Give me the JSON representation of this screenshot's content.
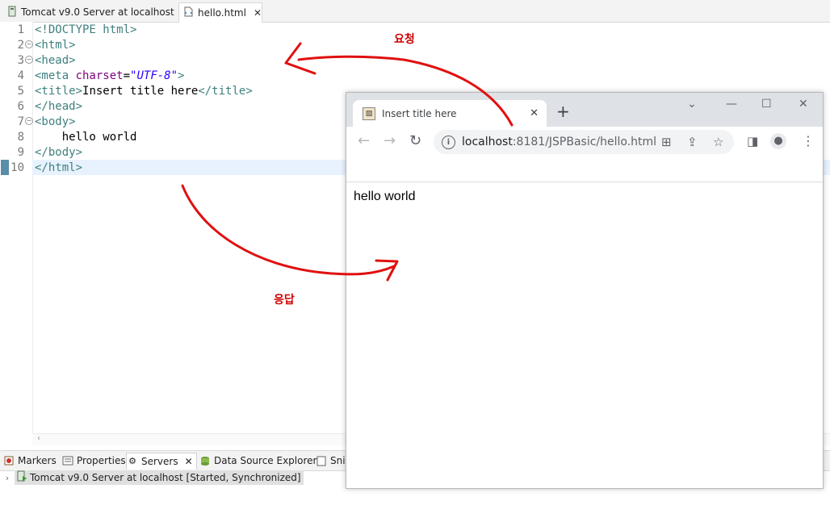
{
  "editor_tabs": [
    {
      "label": "Tomcat v9.0 Server at localhost",
      "icon": "server-icon"
    },
    {
      "label": "hello.html",
      "icon": "html-file-icon"
    }
  ],
  "code": {
    "line_numbers": [
      "1",
      "2",
      "3",
      "4",
      "5",
      "6",
      "7",
      "8",
      "9",
      "10"
    ],
    "l1": "<!DOCTYPE html>",
    "l2": "<html>",
    "l3": "<head>",
    "l4_open": "<meta ",
    "l4_attr": "charset",
    "l4_eq": "=",
    "l4_val": "\"UTF-8\"",
    "l4_close": ">",
    "l5_open": "<title>",
    "l5_text": "Insert title here",
    "l5_close": "</title>",
    "l6": "</head>",
    "l7": "<body>",
    "l8": "    hello world",
    "l9": "</body>",
    "l10": "</html>"
  },
  "bottom_panel": {
    "tabs": [
      {
        "label": "Markers"
      },
      {
        "label": "Properties"
      },
      {
        "label": "Servers"
      },
      {
        "label": "Data Source Explorer"
      },
      {
        "label": "Sni"
      }
    ],
    "server_entry": "Tomcat v9.0 Server at localhost  [Started, Synchronized]"
  },
  "browser": {
    "tab_title": "Insert title here",
    "url_host": "localhost",
    "url_path": ":8181/JSPBasic/hello.html",
    "page_text": "hello world"
  },
  "annotations": {
    "request": "요청",
    "response": "응답",
    "color": "#d00000"
  }
}
